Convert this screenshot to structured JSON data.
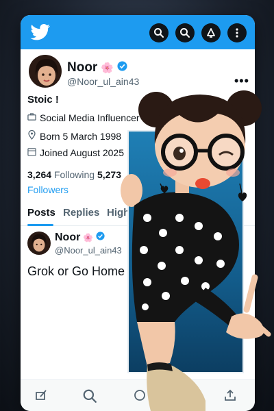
{
  "header": {
    "logo_icon": "twitter-bird-icon",
    "icons": [
      "search-icon",
      "search-icon",
      "notifications-icon",
      "more-vertical-icon"
    ]
  },
  "profile": {
    "name": "Noor",
    "flower_emoji": "🌸",
    "verified_icon": "verified-badge-icon",
    "handle": "@Noor_ul_ain43",
    "more": "•••",
    "bio": "Stoic !",
    "category": "Social Media Influencer",
    "born": "Born 5 March 1998",
    "joined": "Joined August 2025",
    "following_count": "3,264",
    "following_label": "Following",
    "followers_count": "5,273",
    "followers_label": "Followers"
  },
  "tabs": [
    {
      "label": "Posts",
      "active": true
    },
    {
      "label": "Replies",
      "active": false
    },
    {
      "label": "High",
      "active": false
    }
  ],
  "post": {
    "name": "Noor",
    "flower_emoji": "🌸",
    "handle": "@Noor_ul_ain43",
    "text": "Grok or Go Home"
  },
  "bottom_nav": {
    "icons": [
      "compose-icon",
      "search-icon",
      "messages-icon",
      "share-icon"
    ]
  },
  "colors": {
    "brand_blue": "#1d9bf0",
    "text_primary": "#0f1419",
    "text_secondary": "#536471"
  }
}
